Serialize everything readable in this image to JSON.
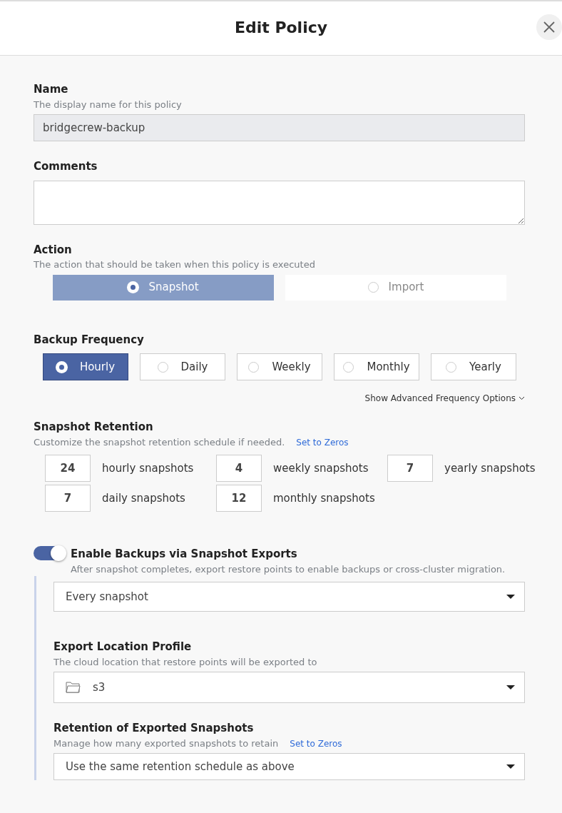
{
  "dialog": {
    "title": "Edit Policy"
  },
  "name": {
    "label": "Name",
    "hint": "The display name for this policy",
    "value": "bridgecrew-backup",
    "disabled": true
  },
  "comments": {
    "label": "Comments"
  },
  "action": {
    "label": "Action",
    "hint": "The action that should be taken when this policy is executed",
    "options": [
      {
        "label": "Snapshot",
        "selected": true
      },
      {
        "label": "Import",
        "selected": false
      }
    ]
  },
  "frequency": {
    "label": "Backup Frequency",
    "options": [
      {
        "label": "Hourly",
        "selected": true
      },
      {
        "label": "Daily",
        "selected": false
      },
      {
        "label": "Weekly",
        "selected": false
      },
      {
        "label": "Monthly",
        "selected": false
      },
      {
        "label": "Yearly",
        "selected": false
      }
    ],
    "advanced_link": "Show Advanced Frequency Options"
  },
  "retention": {
    "label": "Snapshot Retention",
    "hint": "Customize the snapshot retention schedule if needed.",
    "reset_link": "Set to Zeros",
    "items": [
      {
        "value": "24",
        "label": "hourly snapshots"
      },
      {
        "value": "4",
        "label": "weekly snapshots"
      },
      {
        "value": "7",
        "label": "yearly snapshots"
      },
      {
        "value": "7",
        "label": "daily snapshots"
      },
      {
        "value": "12",
        "label": "monthly snapshots"
      }
    ]
  },
  "exports": {
    "on": true,
    "label": "Enable Backups via Snapshot Exports",
    "hint": "After snapshot completes, export restore points to enable backups or cross-cluster migration.",
    "schedule": "Every snapshot",
    "location": {
      "label": "Export Location Profile",
      "hint": "The cloud location that restore points will be exported to",
      "value": "s3"
    },
    "retention": {
      "label": "Retention of Exported Snapshots",
      "hint": "Manage how many exported snapshots to retain",
      "reset_link": "Set to Zeros",
      "value": "Use the same retention schedule as above"
    }
  }
}
